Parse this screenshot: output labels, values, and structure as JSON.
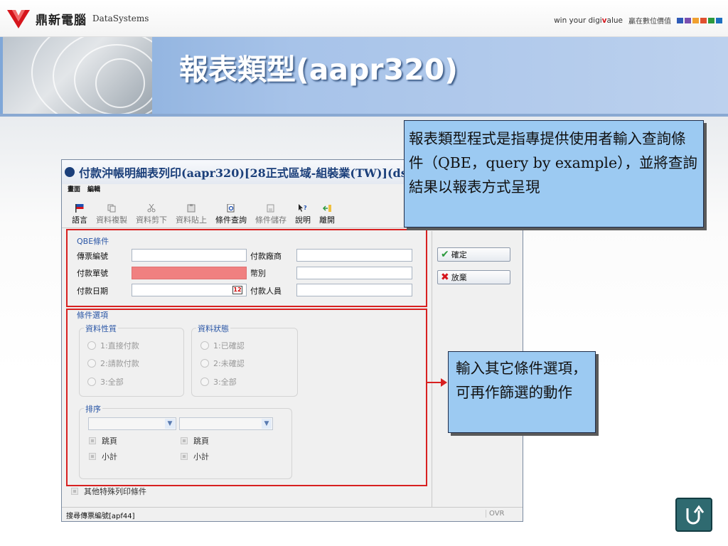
{
  "header": {
    "brand_cn": "鼎新電腦",
    "brand_en": "DataSystems",
    "slogan_prefix": "win your digi",
    "slogan_v": "v",
    "slogan_suffix": "alue",
    "slogan_cn": "贏在數位價值",
    "slogan_colors": [
      "#2f5bb7",
      "#7a4fb0",
      "#f0a030",
      "#e0502f",
      "#2d9a3e",
      "#1d6fc0"
    ]
  },
  "banner": {
    "title": "報表類型(aapr320)"
  },
  "window": {
    "title": "付款沖帳明細表列印(aapr320)[28正式區域-組裝業(TW)](ds",
    "menu": [
      "畫面",
      "編輯"
    ],
    "toolbar": [
      {
        "label": "語言",
        "icon": "flag-icon",
        "enabled": true
      },
      {
        "label": "資料複製",
        "icon": "copy-icon",
        "enabled": false
      },
      {
        "label": "資料剪下",
        "icon": "scissors-icon",
        "enabled": false
      },
      {
        "label": "資料貼上",
        "icon": "paste-icon",
        "enabled": false
      },
      {
        "label": "條件查詢",
        "icon": "query-icon",
        "enabled": true
      },
      {
        "label": "條件儲存",
        "icon": "save-condition-icon",
        "enabled": false
      },
      {
        "label": "說明",
        "icon": "help-icon",
        "enabled": true
      },
      {
        "label": "離開",
        "icon": "exit-icon",
        "enabled": true
      }
    ],
    "qbe": {
      "title": "QBE條件",
      "fields": {
        "voucher_no": {
          "label": "傳票編號",
          "value": ""
        },
        "payment_no": {
          "label": "付款單號",
          "value": ""
        },
        "payment_date": {
          "label": "付款日期",
          "value": ""
        },
        "vendor": {
          "label": "付款廠商",
          "value": ""
        },
        "currency": {
          "label": "幣別",
          "value": ""
        },
        "payer": {
          "label": "付款人員",
          "value": ""
        }
      },
      "calendar_glyph": "12"
    },
    "options": {
      "title": "條件選項",
      "nature": {
        "title": "資料性質",
        "items": [
          "1:直接付款",
          "2:請款付款",
          "3:全部"
        ]
      },
      "status": {
        "title": "資料狀態",
        "items": [
          "1:已確認",
          "2:未確認",
          "3:全部"
        ]
      },
      "sort": {
        "title": "排序",
        "select1": "",
        "select2": "",
        "page_break_1": "跳頁",
        "subtotal_1": "小計",
        "page_break_2": "跳頁",
        "subtotal_2": "小計"
      },
      "special_print": "其他特殊列印條件"
    },
    "buttons": {
      "confirm": "確定",
      "cancel": "放棄"
    },
    "status_bar": {
      "text": "搜尋傳票編號[apf44]",
      "ovr": "OVR"
    }
  },
  "callouts": {
    "top": "報表類型程式是指專提供使用者輸入查詢條件（QBE，query by example），並將查詢結果以報表方式呈現",
    "side": "輸入其它條件選項，可再作篩選的動作"
  },
  "colors": {
    "accent_blue": "#1b3f7a",
    "required_field": "#f08080",
    "highlight_red": "#d82020",
    "callout_fill": "#9ccaf2",
    "back_button": "#2f6a70"
  }
}
